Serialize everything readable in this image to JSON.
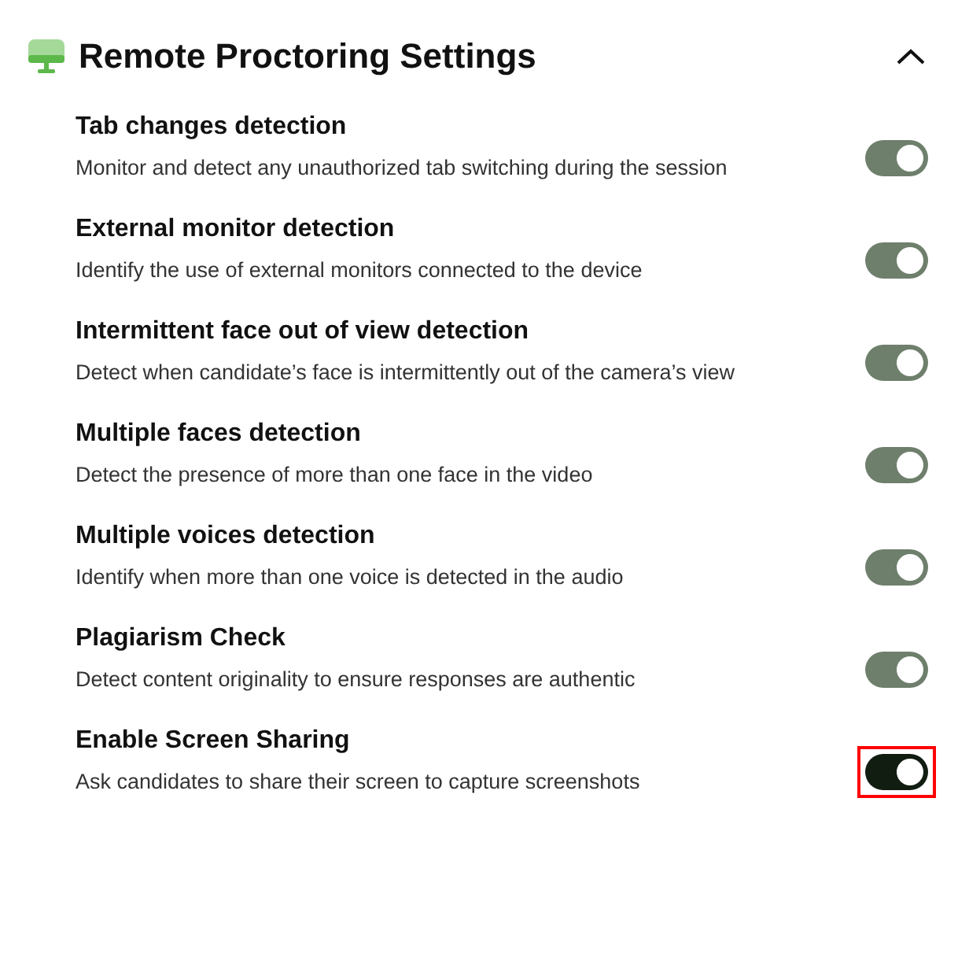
{
  "section": {
    "title": "Remote Proctoring Settings",
    "expanded": true
  },
  "settings": [
    {
      "title": "Tab changes detection",
      "description": "Monitor and detect any unauthorized tab switching during the session",
      "on": true,
      "disabled": true,
      "highlighted": false
    },
    {
      "title": "External monitor detection",
      "description": "Identify the use of external monitors connected to the device",
      "on": true,
      "disabled": true,
      "highlighted": false
    },
    {
      "title": "Intermittent face out of view detection",
      "description": "Detect when candidate’s face is intermittently out of the camera’s view",
      "on": true,
      "disabled": true,
      "highlighted": false
    },
    {
      "title": "Multiple faces detection",
      "description": "Detect the presence of more than one face in the video",
      "on": true,
      "disabled": true,
      "highlighted": false
    },
    {
      "title": "Multiple voices detection",
      "description": "Identify when more than one voice is detected in the audio",
      "on": true,
      "disabled": true,
      "highlighted": false
    },
    {
      "title": "Plagiarism Check",
      "description": "Detect content originality to ensure responses are authentic",
      "on": true,
      "disabled": true,
      "highlighted": false
    },
    {
      "title": "Enable Screen Sharing",
      "description": "Ask candidates to share their screen to capture screenshots",
      "on": true,
      "disabled": false,
      "highlighted": true
    }
  ]
}
